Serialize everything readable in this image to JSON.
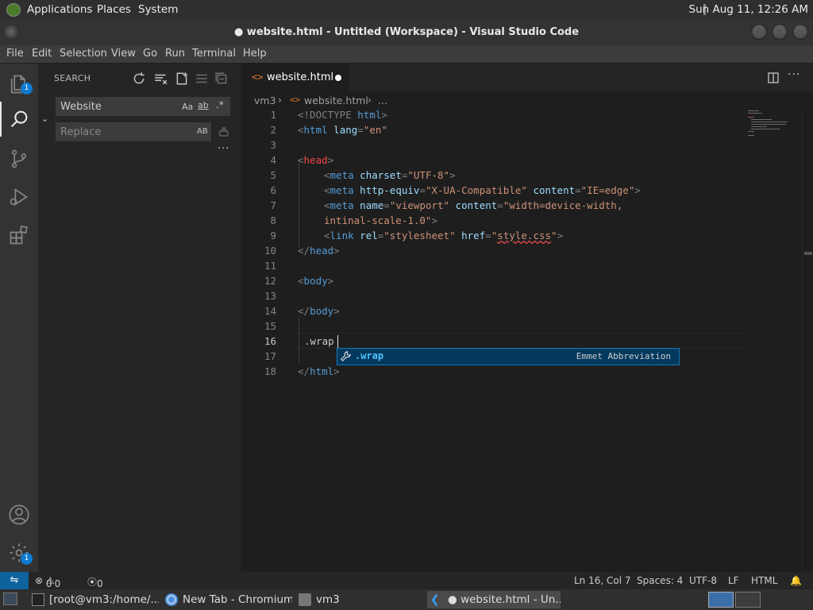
{
  "top_panel": {
    "applications": "Applications",
    "places": "Places",
    "system": "System",
    "clock": "Sun Aug 11, 12:26 AM"
  },
  "window": {
    "title": "● website.html - Untitled (Workspace) - Visual Studio Code"
  },
  "menubar": [
    "File",
    "Edit",
    "Selection",
    "View",
    "Go",
    "Run",
    "Terminal",
    "Help"
  ],
  "activity_bar": {
    "explorer_badge": "1",
    "settings_badge": "1"
  },
  "sidebar": {
    "title": "SEARCH",
    "search_value": "Website",
    "replace_placeholder": "Replace",
    "match_case": "Aa",
    "whole_word": "ab",
    "regex": ".*",
    "preserve_case": "AB",
    "more": "..."
  },
  "editor": {
    "tab_label": "website.html",
    "breadcrumb": {
      "folder": "vm3",
      "file": "website.html",
      "ellipsis": "..."
    },
    "line_numbers": [
      "1",
      "2",
      "3",
      "4",
      "5",
      "6",
      "7",
      "8",
      "9",
      "10",
      "11",
      "12",
      "13",
      "14",
      "15",
      "16",
      "17",
      "18"
    ],
    "code": {
      "l1_a": "<!DOCTYPE",
      "l1_b": " html",
      "l1_c": ">",
      "l2_a": "<",
      "l2_b": "html",
      "l2_c": " lang",
      "l2_d": "=",
      "l2_e": "\"en\"",
      "l4_a": "<",
      "l4_b": "head",
      "l4_c": ">",
      "l5": "<meta charset=\"UTF-8\">",
      "l5_tag": "meta",
      "l5_attr": "charset",
      "l5_val": "\"UTF-8\"",
      "l6_tag": "meta",
      "l6_attr1": "http-equiv",
      "l6_val1": "\"X-UA-Compatible\"",
      "l6_attr2": "content",
      "l6_val2": "\"IE=edge\"",
      "l7_tag": "meta",
      "l7_attr1": "name",
      "l7_val1": "\"viewport\"",
      "l7_attr2": "content",
      "l7_val2": "\"width=device-width,",
      "l8_val": "intinal-scale-1.0\"",
      "l9_tag": "link",
      "l9_attr1": "rel",
      "l9_val1": "\"stylesheet\"",
      "l9_attr2": "href",
      "l9_val2a": "\"",
      "l9_val2b": "style.css",
      "l9_val2c": "\"",
      "l10_tag": "head",
      "l12_tag": "body",
      "l14_tag": "body",
      "l16": ".wrap",
      "l18_tag": "html"
    },
    "suggestion": {
      "label": ".wrap",
      "detail": "Emmet Abbreviation"
    }
  },
  "statusbar": {
    "errors": "0",
    "warnings": "0",
    "ports": "0",
    "position": "Ln 16, Col 7",
    "spaces": "Spaces: 4",
    "encoding": "UTF-8",
    "eol": "LF",
    "language": "HTML"
  },
  "taskbar": {
    "terminal": "[root@vm3:/home/...",
    "chromium": "New Tab - Chromium",
    "files": "vm3",
    "vscode": "● website.html - Un..."
  },
  "colors": {
    "accent": "#0e639c",
    "tag": "#569cd6",
    "attr": "#9cdcfe",
    "string": "#ce9178"
  }
}
